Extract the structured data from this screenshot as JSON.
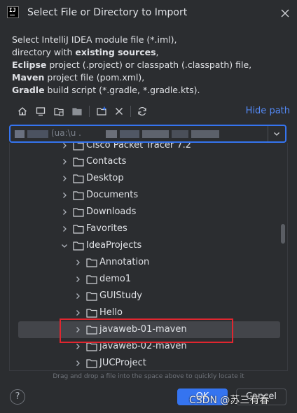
{
  "dialog": {
    "title": "Select File or Directory to Import",
    "logo_text": "IJ"
  },
  "description": {
    "line1": "Select IntelliJ IDEA module file (*.iml),",
    "line2_pre": "directory with ",
    "line2_bold": "existing sources",
    "line2_post": ",",
    "line3_bold": "Eclipse",
    "line3_rest": " project (.project) or classpath (.classpath) file,",
    "line4_bold": "Maven",
    "line4_rest": " project file (pom.xml),",
    "line5_bold": "Gradle",
    "line5_rest": " build script (*.gradle, *.gradle.kts)."
  },
  "toolbar": {
    "hide_path_label": "Hide path",
    "icons": [
      "home-icon",
      "desktop-icon",
      "project-folder-icon",
      "module-folder-icon",
      "new-folder-icon",
      "delete-icon",
      "refresh-icon"
    ]
  },
  "path": {
    "value_partial": "(ua:\\u   ."
  },
  "tree": {
    "rows": [
      {
        "label": "Cisco Packet Tracer 7.2",
        "level": 0,
        "expanded": false
      },
      {
        "label": "Contacts",
        "level": 0,
        "expanded": false
      },
      {
        "label": "Desktop",
        "level": 0,
        "expanded": false
      },
      {
        "label": "Documents",
        "level": 0,
        "expanded": false
      },
      {
        "label": "Downloads",
        "level": 0,
        "expanded": false
      },
      {
        "label": "Favorites",
        "level": 0,
        "expanded": false
      },
      {
        "label": "IdeaProjects",
        "level": 0,
        "expanded": true
      },
      {
        "label": "Annotation",
        "level": 1,
        "expanded": false
      },
      {
        "label": "demo1",
        "level": 1,
        "expanded": false
      },
      {
        "label": "GUIStudy",
        "level": 1,
        "expanded": false
      },
      {
        "label": "Hello",
        "level": 1,
        "expanded": false
      },
      {
        "label": "javaweb-01-maven",
        "level": 1,
        "expanded": false,
        "selected": true
      },
      {
        "label": "javaweb-02-maven",
        "level": 1,
        "expanded": false
      },
      {
        "label": "JUCProject",
        "level": 1,
        "expanded": false
      }
    ]
  },
  "hint": "Drag and drop a file into the space above to quickly locate it",
  "buttons": {
    "help": "?",
    "ok": "OK",
    "cancel": "Cancel"
  },
  "watermark": "CSDN @苏三有春",
  "colors": {
    "background": "#2b2d30",
    "accent": "#3574f0",
    "link": "#548af7",
    "selection": "#43454a",
    "annotation_box": "#e0262f"
  }
}
